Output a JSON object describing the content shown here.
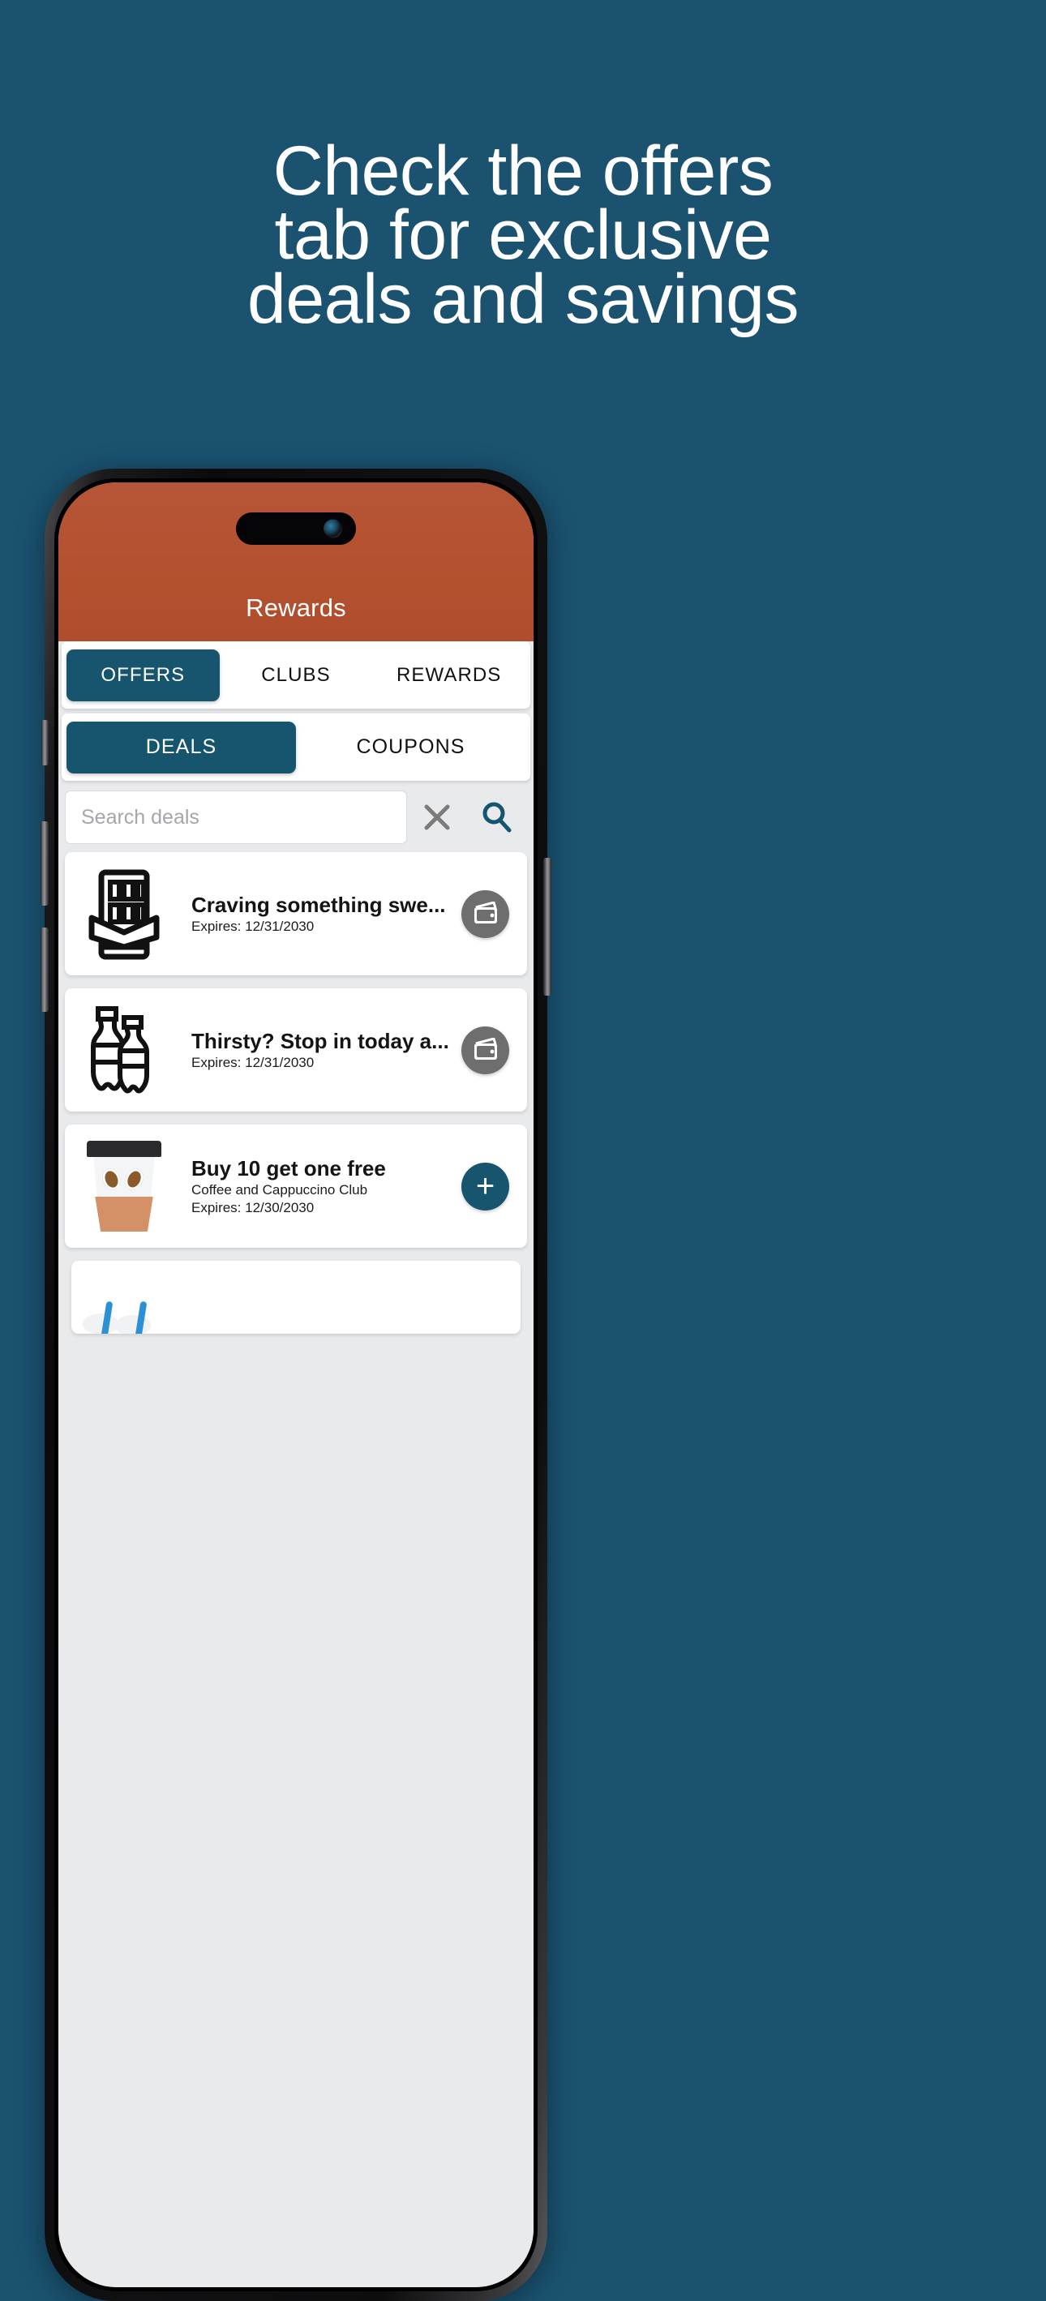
{
  "promo": {
    "headline_lines": [
      "Check the offers",
      "tab for exclusive",
      "deals and savings"
    ],
    "background_color": "#1a5270",
    "text_color": "#ffffff"
  },
  "app": {
    "title": "Rewards",
    "header_color": "#b4512f",
    "accent_color": "#17556f",
    "primary_tabs": [
      {
        "label": "OFFERS",
        "active": true
      },
      {
        "label": "CLUBS",
        "active": false
      },
      {
        "label": "REWARDS",
        "active": false
      }
    ],
    "secondary_tabs": [
      {
        "label": "DEALS",
        "active": true
      },
      {
        "label": "COUPONS",
        "active": false
      }
    ],
    "search": {
      "placeholder": "Search deals",
      "value": "",
      "clear_icon": "close-x-icon",
      "search_icon": "magnifier-icon"
    },
    "deals": [
      {
        "title": "Craving something swe...",
        "subtitle": "",
        "expires": "Expires: 12/31/2030",
        "icon": "chocolate-bar-icon",
        "action": "wallet-icon",
        "action_color": "#6e6e6e"
      },
      {
        "title": "Thirsty? Stop in today a...",
        "subtitle": "",
        "expires": "Expires: 12/31/2030",
        "icon": "soda-bottles-icon",
        "action": "wallet-icon",
        "action_color": "#6e6e6e"
      },
      {
        "title": "Buy 10 get one free",
        "subtitle": "Coffee and Cappuccino Club",
        "expires": "Expires: 12/30/2030",
        "icon": "coffee-cup-icon",
        "action": "plus-icon",
        "action_label": "+",
        "action_color": "#17556f"
      }
    ]
  }
}
